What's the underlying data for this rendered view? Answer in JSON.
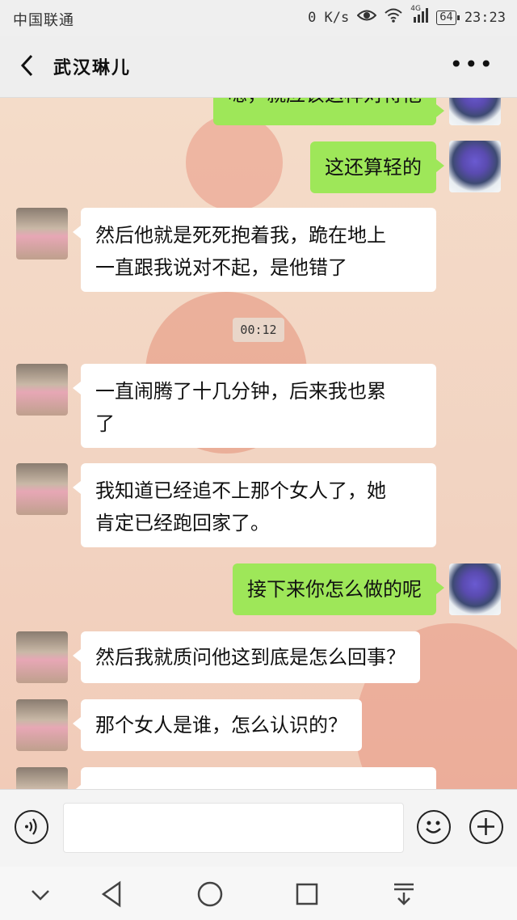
{
  "status_bar": {
    "carrier": "中国联通",
    "network_speed": "0 K/s",
    "signal_label": "4G",
    "battery": "64",
    "time": "23:23"
  },
  "header": {
    "title": "武汉琳儿",
    "back_icon": "chevron-left-icon",
    "more_icon": "more-dots-icon"
  },
  "messages": [
    {
      "side": "out",
      "text": "嗯，就应该这样对待他"
    },
    {
      "side": "out",
      "text": "这还算轻的"
    },
    {
      "side": "in",
      "line1": "然后他就是死死抱着我，跪在地上",
      "line2": "一直跟我说对不起，是他错了"
    },
    {
      "side": "time",
      "text": "00:12"
    },
    {
      "side": "in",
      "line1": "一直闹腾了十几分钟，后来我也累",
      "line2": "了"
    },
    {
      "side": "in",
      "line1": "我知道已经追不上那个女人了，她",
      "line2": "肯定已经跑回家了。"
    },
    {
      "side": "out",
      "text": "接下来你怎么做的呢"
    },
    {
      "side": "in",
      "text": "然后我就质问他这到底是怎么回事？"
    },
    {
      "side": "in",
      "text": "那个女人是谁，怎么认识的？"
    }
  ],
  "input_bar": {
    "voice_icon": "voice-icon",
    "emoji_icon": "emoji-icon",
    "plus_icon": "plus-icon"
  },
  "nav_bar": {
    "icons": [
      "chevron-down-icon",
      "back-triangle-icon",
      "home-circle-icon",
      "recents-square-icon",
      "notification-pull-icon"
    ]
  },
  "colors": {
    "out_bubble": "#9ee759",
    "in_bubble": "#ffffff",
    "chat_bg": "#f3d8c8"
  }
}
